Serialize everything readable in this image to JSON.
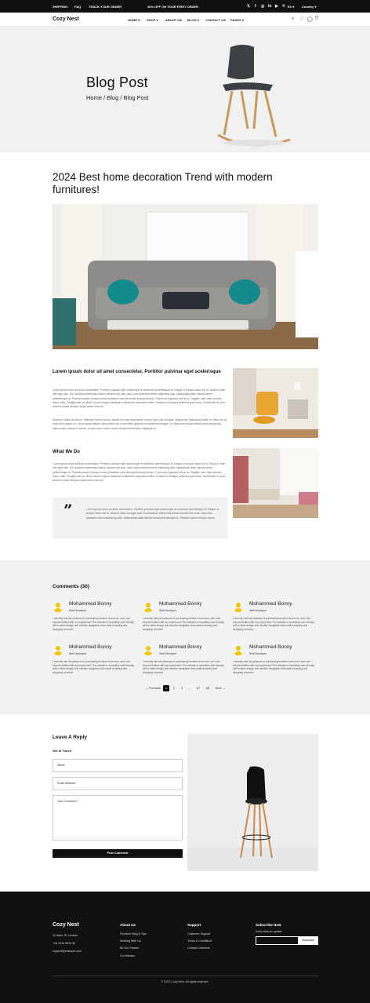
{
  "topbar": {
    "shipping": "SHIPPING",
    "faq": "FAQ",
    "track": "TRACK YOUR ORDER",
    "promo": "20% OFF ON YOUR FIRST ORDER",
    "lang": "En",
    "country": "Country"
  },
  "nav": {
    "logo": "Cozy Nest",
    "items": [
      "HOME",
      "SHOP",
      "ABOUT US",
      "BLOG",
      "CONTACT US",
      "PAGES"
    ]
  },
  "hero": {
    "title": "Blog Post",
    "breadcrumb": "Home / Blog / Blog Post"
  },
  "article": {
    "title": "2024 Best home decoration Trend with modern furnitures!",
    "sub1": "Lorem ipsum dolor sit amet consectetur. Porttitor pulvinar eget scelerisque",
    "p1": "Lorem ipsum dolor sit amet consectetur. Porttitor pulvinar eget scelerisque et senectus pellentesque id. Neque ut tempor diam orci ut. Nulla in vitae nisi eget odio. Dui faucibus maecenas dictum laoreet sed cras. Nam odio praesent lorem adipiscing odio. Malesuada vitae ultricies amet pellentesque id. Pharetra auctor tempor luctus phasellus nulla dictumst tempus dictum. Commodo egestas velit at ac. Sagittis odio vitae aenean tellus nulla. Fringilla nam eu libero donec magna habitasse sollicitudin vulputate mattis. Sodales ut tristique pellentesque lectus. Sollicitudin et proin amet et neque tempus turpis amet rhoncus.",
    "p2": "Morbi leo tortor ac nisi mi. Interdum lorem cursus. Massa sed nisl consectetur neque eget odio volutpat. Magna nec adipiscing mattis in. Risus ne ac duis amet neque mi. Lacus quam aliquet luctus tellus dui consectetur gravida condimentum feugiat. Ut vitae amet suspendisse tellus adipiscing ullamcorper massa in sed ac. Ut quis dolor luctus tortor volutpat elementum dignissim ut.",
    "sub2": "What We Do",
    "p3": "Lorem ipsum dolor sit amet consectetur. Porttitor pulvinar eget scelerisque et senectus pellentesque id. Neque ut tempor diam orci ut. Nulla in vitae nisi eget odio. Dui faucibus maecenas dictum laoreet sed cras. Nam odio praesent lorem adipiscing odio. Malesuada vitae ultricies amet pellentesque id. Pharetra auctor tempor luctus phasellus nulla dictumst tempus dictum. Commodo egestas velit at ac. Sagittis odio vitae aenean tellus nulla. Fringilla nam eu libero donec magna habitasse sollicitudin vulputate mattis. Sodales ut tristique pellentesque lectus. Sollicitudin et proin amet et neque tempus turpis amet rhoncus.",
    "quote": "Lorem ipsum dolor sit amet consectetur. Porttitor pulvinar eget scelerisque et senectus pellentesque id. Neque ut tempor diam orci ut. Nulla in vitae nisi eget odio. Dui faucibus maecenas dictum laoreet sed cras. Nam odio praesent lorem adipiscing odio. Malesuada vitae ultricies amet pellentesque id. Pharetra auctor tempor luctus."
  },
  "comments": {
    "heading": "Comments (30)",
    "items": [
      {
        "name": "Mohammed Bonny",
        "role": "Web Developer",
        "text": "I recently had the pleasure of purchasing furniture from here, and I am beyond thrilled with my experience! The website is incredibly user-friendly, with a sleek design and intuitive navigation that made browsing and shopping a breeze."
      },
      {
        "name": "Mohammed Bonny",
        "role": "Web Developer",
        "text": "I recently had the pleasure of purchasing furniture from here, and I am beyond thrilled with my experience! The website is incredibly user-friendly, with a sleek design and intuitive navigation that made browsing and shopping a breeze."
      },
      {
        "name": "Mohammed Bonny",
        "role": "Web Developer",
        "text": "I recently had the pleasure of purchasing furniture from here, and I am beyond thrilled with my experience! The website is incredibly user-friendly, with a sleek design and intuitive navigation that made browsing and shopping a breeze."
      },
      {
        "name": "Mohammed Bonny",
        "role": "Web Developer",
        "text": "I recently had the pleasure of purchasing furniture from here, and I am beyond thrilled with my experience! The website is incredibly user-friendly, with a sleek design and intuitive navigation that made browsing and shopping a breeze."
      },
      {
        "name": "Mohammed Bonny",
        "role": "Web Developer",
        "text": "I recently had the pleasure of purchasing furniture from here, and I am beyond thrilled with my experience! The website is incredibly user-friendly, with a sleek design and intuitive navigation that made browsing and shopping a breeze."
      },
      {
        "name": "Mohammed Bonny",
        "role": "Web Developer",
        "text": "I recently had the pleasure of purchasing furniture from here, and I am beyond thrilled with my experience! The website is incredibly user-friendly, with a sleek design and intuitive navigation that made browsing and shopping a breeze."
      }
    ],
    "pager": {
      "prev": "← Previous",
      "pages": [
        "1",
        "2",
        "3",
        "...",
        "67",
        "68"
      ],
      "next": "Next →"
    }
  },
  "reply": {
    "heading": "Leave A Reply",
    "sub": "Get In Touch",
    "name_ph": "Name",
    "email_ph": "Email Address *",
    "comment_ph": "Your Comment *",
    "button": "Post Comment"
  },
  "footer": {
    "logo": "Cozy Nest",
    "address": "12 Main, Pt, London",
    "phone": "+44 1234 5678 90",
    "email": "support@example.com",
    "about_title": "About Us",
    "about": [
      "Furniture Blog & Tips",
      "Working With Us",
      "Be Our Partner",
      "Our Mission"
    ],
    "support_title": "Support",
    "support": [
      "Customer Support",
      "Terms & Conditions",
      "Contact Channels"
    ],
    "sub_title": "Subscribe Now",
    "sub_text": "Don't miss an update",
    "sub_button": "Subscribe",
    "copyright": "© 2024 Cozy Nest. All rights reserved."
  }
}
